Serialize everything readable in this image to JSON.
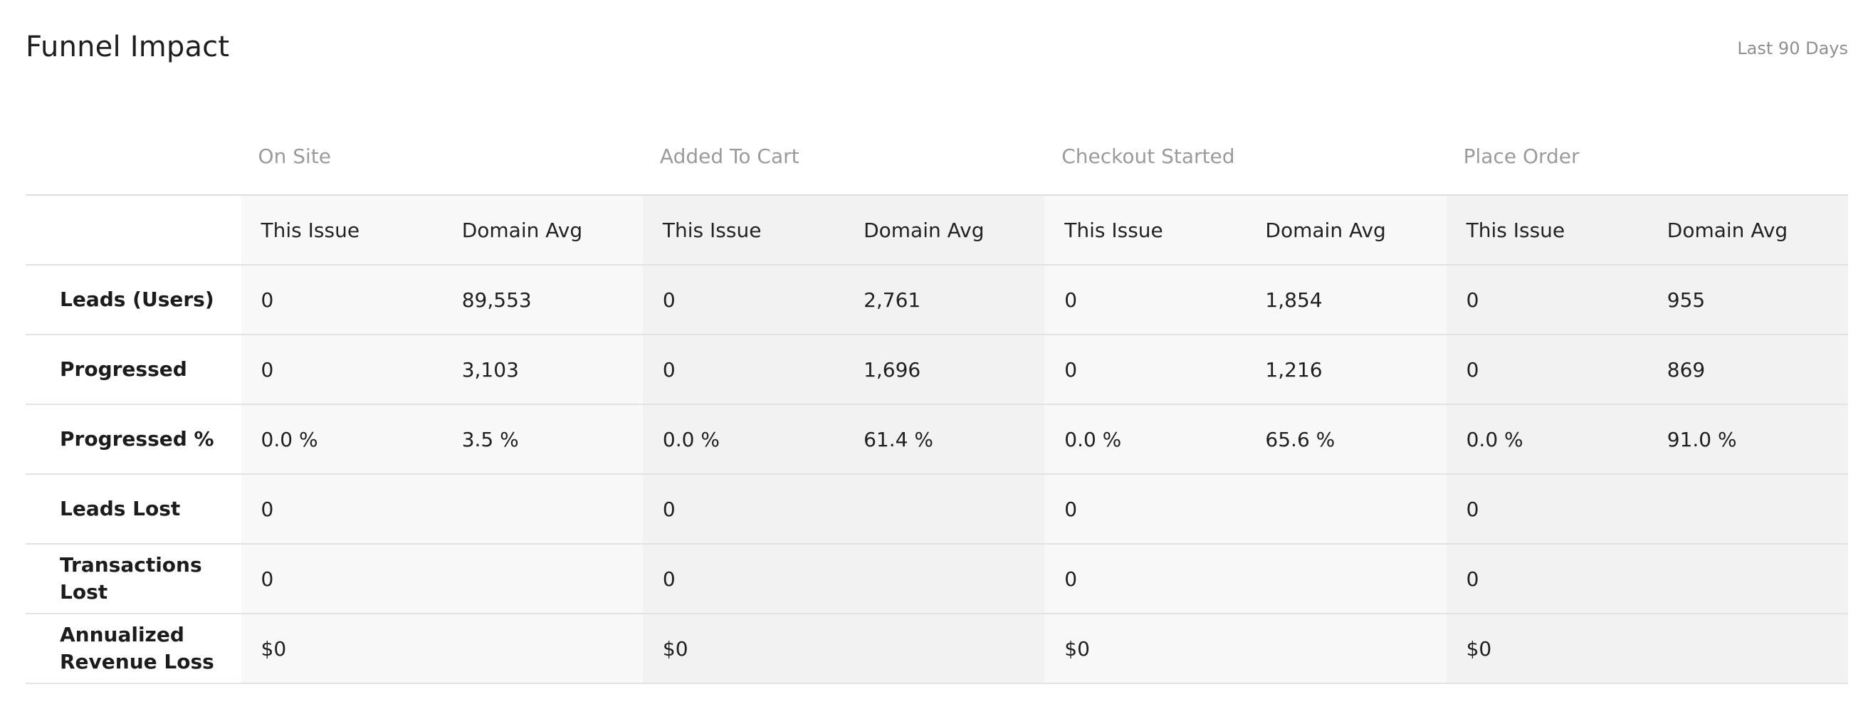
{
  "header": {
    "title": "Funnel Impact",
    "range": "Last 90 Days"
  },
  "table": {
    "stages": [
      "On Site",
      "Added To Cart",
      "Checkout Started",
      "Place Order"
    ],
    "subheaders": {
      "this_issue": "This Issue",
      "domain_avg": "Domain Avg"
    },
    "rows": [
      {
        "label": "Leads (Users)",
        "cells": [
          "0",
          "89,553",
          "0",
          "2,761",
          "0",
          "1,854",
          "0",
          "955"
        ]
      },
      {
        "label": "Progressed",
        "cells": [
          "0",
          "3,103",
          "0",
          "1,696",
          "0",
          "1,216",
          "0",
          "869"
        ]
      },
      {
        "label": "Progressed %",
        "cells": [
          "0.0 %",
          "3.5 %",
          "0.0 %",
          "61.4 %",
          "0.0 %",
          "65.6 %",
          "0.0 %",
          "91.0 %"
        ]
      },
      {
        "label": "Leads Lost",
        "cells": [
          "0",
          "",
          "0",
          "",
          "0",
          "",
          "0",
          ""
        ]
      },
      {
        "label": "Transactions Lost",
        "cells": [
          "0",
          "",
          "0",
          "",
          "0",
          "",
          "0",
          ""
        ]
      },
      {
        "label": "Annualized Revenue Loss",
        "cells": [
          "$0",
          "",
          "$0",
          "",
          "$0",
          "",
          "$0",
          ""
        ]
      }
    ]
  }
}
